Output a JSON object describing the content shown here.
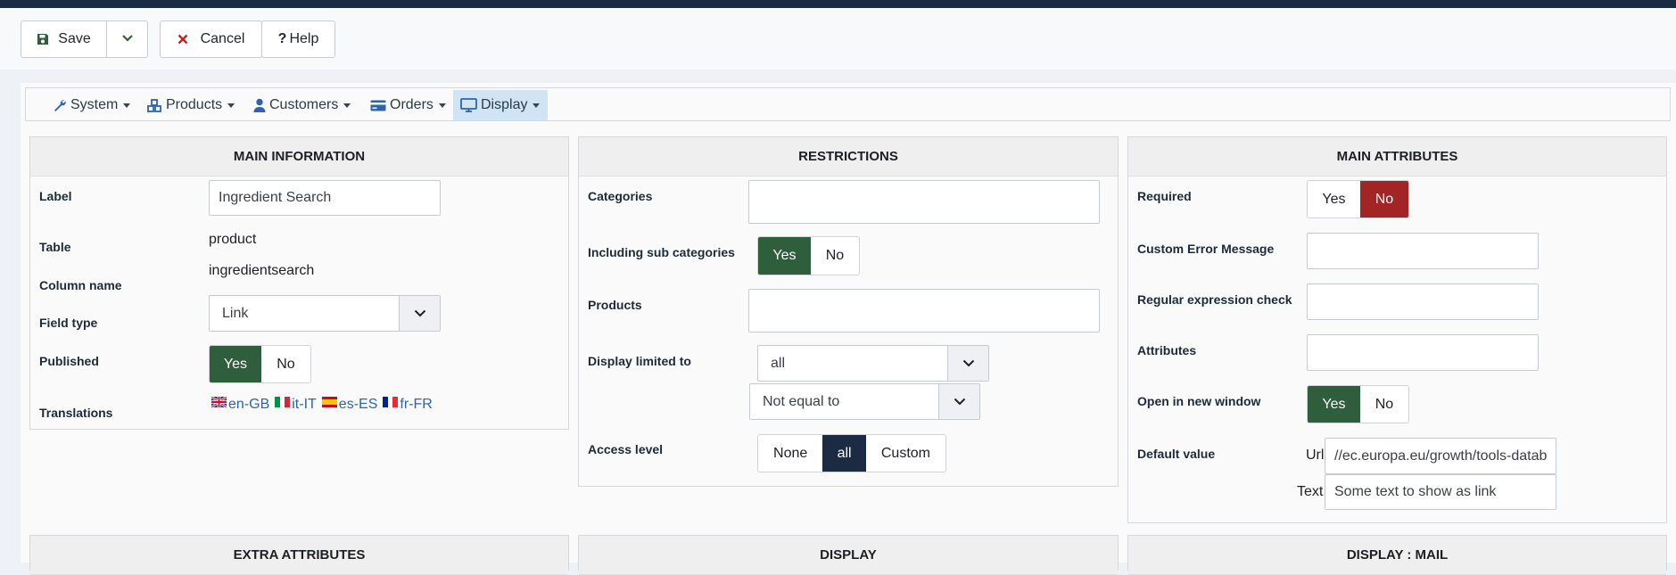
{
  "toolbar": {
    "save_label": "Save",
    "cancel_label": "Cancel",
    "help_label": "Help"
  },
  "menu": {
    "items": [
      {
        "label": "System",
        "icon": "wrench-icon"
      },
      {
        "label": "Products",
        "icon": "cubes-icon"
      },
      {
        "label": "Customers",
        "icon": "user-icon"
      },
      {
        "label": "Orders",
        "icon": "credit-card-icon"
      },
      {
        "label": "Display",
        "icon": "monitor-icon",
        "active": true
      }
    ]
  },
  "main_info": {
    "title": "MAIN INFORMATION",
    "label_label": "Label",
    "label_value": "Ingredient Search",
    "table_label": "Table",
    "table_value": "product",
    "column_label": "Column name",
    "column_value": "ingredientsearch",
    "fieldtype_label": "Field type",
    "fieldtype_value": "Link",
    "published_label": "Published",
    "published_yes": "Yes",
    "published_no": "No",
    "translations_label": "Translations",
    "translations": [
      "en-GB",
      "it-IT",
      "es-ES",
      "fr-FR"
    ]
  },
  "restrictions": {
    "title": "RESTRICTIONS",
    "categories_label": "Categories",
    "subcat_label": "Including sub categories",
    "subcat_yes": "Yes",
    "subcat_no": "No",
    "products_label": "Products",
    "display_limited_label": "Display limited to",
    "display_limited_value": "all",
    "display_limited_op": "Not equal to",
    "access_label": "Access level",
    "access_none": "None",
    "access_all": "all",
    "access_custom": "Custom"
  },
  "main_attributes": {
    "title": "MAIN ATTRIBUTES",
    "required_label": "Required",
    "required_yes": "Yes",
    "required_no": "No",
    "error_label": "Custom Error Message",
    "regex_label": "Regular expression check",
    "attributes_label": "Attributes",
    "newwindow_label": "Open in new window",
    "newwindow_yes": "Yes",
    "newwindow_no": "No",
    "default_label": "Default value",
    "url_label": "Url",
    "url_value": "//ec.europa.eu/growth/tools-datab",
    "text_label": "Text",
    "text_value": "Some text to show as link"
  },
  "bottom_panels": {
    "extra": "EXTRA ATTRIBUTES",
    "display": "DISPLAY",
    "display_mail": "DISPLAY : MAIL"
  },
  "colors": {
    "green": "#2e5e3c",
    "red": "#a32424",
    "navy": "#1c2b44",
    "link": "#2d63b0",
    "active_menu": "#cfe4f5"
  }
}
